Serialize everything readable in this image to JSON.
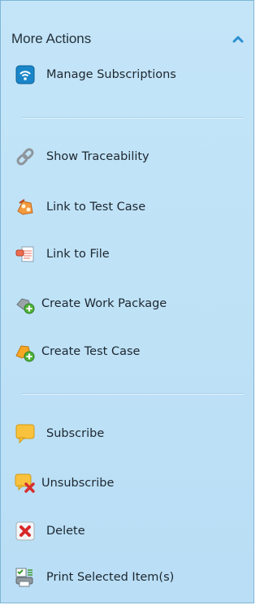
{
  "panel": {
    "title": "More Actions",
    "collapse_icon": "chevron-up-icon",
    "accent": "#2a8fd0"
  },
  "items": [
    {
      "label": "Manage Subscriptions",
      "icon": "subscriptions-icon"
    },
    {
      "label": "Show Traceability",
      "icon": "chain-link-icon"
    },
    {
      "label": "Link to Test Case",
      "icon": "link-test-case-icon"
    },
    {
      "label": "Link to File",
      "icon": "link-file-icon"
    },
    {
      "label": "Create Work Package",
      "icon": "create-work-package-icon"
    },
    {
      "label": "Create Test Case",
      "icon": "create-test-case-icon"
    },
    {
      "label": "Subscribe",
      "icon": "speech-bubble-icon"
    },
    {
      "label": "Unsubscribe",
      "icon": "unsubscribe-icon"
    },
    {
      "label": "Delete",
      "icon": "delete-icon"
    },
    {
      "label": "Print Selected Item(s)",
      "icon": "print-items-icon"
    }
  ]
}
